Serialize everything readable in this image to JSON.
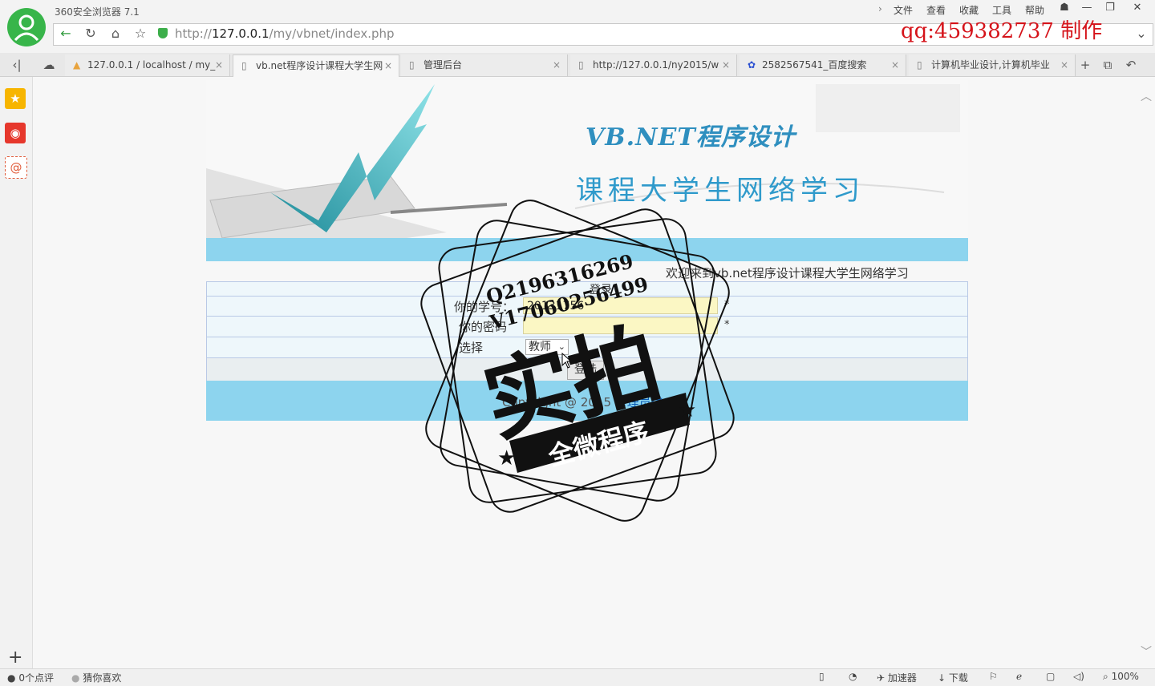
{
  "browser": {
    "title": "360安全浏览器 7.1",
    "menu": [
      "文件",
      "查看",
      "收藏",
      "工具",
      "帮助"
    ],
    "url_prefix": "http://",
    "url_host": "127.0.0.1",
    "url_path": "/my/vbnet/index.php",
    "overlay_text": "qq:459382737 制作"
  },
  "tabs": [
    {
      "label": "127.0.0.1 / localhost / my_",
      "icon": "phpmyadmin-icon"
    },
    {
      "label": "vb.net程序设计课程大学生网",
      "icon": "page-icon"
    },
    {
      "label": "管理后台",
      "icon": "page-icon"
    },
    {
      "label": "http://127.0.0.1/ny2015/w",
      "icon": "page-icon"
    },
    {
      "label": "2582567541_百度搜索",
      "icon": "baidu-icon"
    },
    {
      "label": "计算机毕业设计,计算机毕业",
      "icon": "page-icon"
    }
  ],
  "page": {
    "banner_title1": "VB.NET程序设计",
    "banner_title2": "课程大学生网络学习",
    "welcome": "欢迎来到vb.net程序设计课程大学生网络学习",
    "login_header": "登录",
    "student_id_label": "你的学号：",
    "student_id_value": "20131756",
    "password_label": "你的密码",
    "role_label": "选择",
    "role_value": "教师",
    "required_mark": "*",
    "login_button": "登陆",
    "copyright": "Copyright @ 2015",
    "admin_link": "管理员登"
  },
  "stamp": {
    "line1": "Q2196316269",
    "line2": "V17060256499",
    "main": "实拍",
    "ribbon": "全微程序"
  },
  "status": {
    "comments": "0个点评",
    "guess": "猜你喜欢",
    "accelerator": "加速器",
    "download": "下载",
    "zoom": "100%"
  }
}
